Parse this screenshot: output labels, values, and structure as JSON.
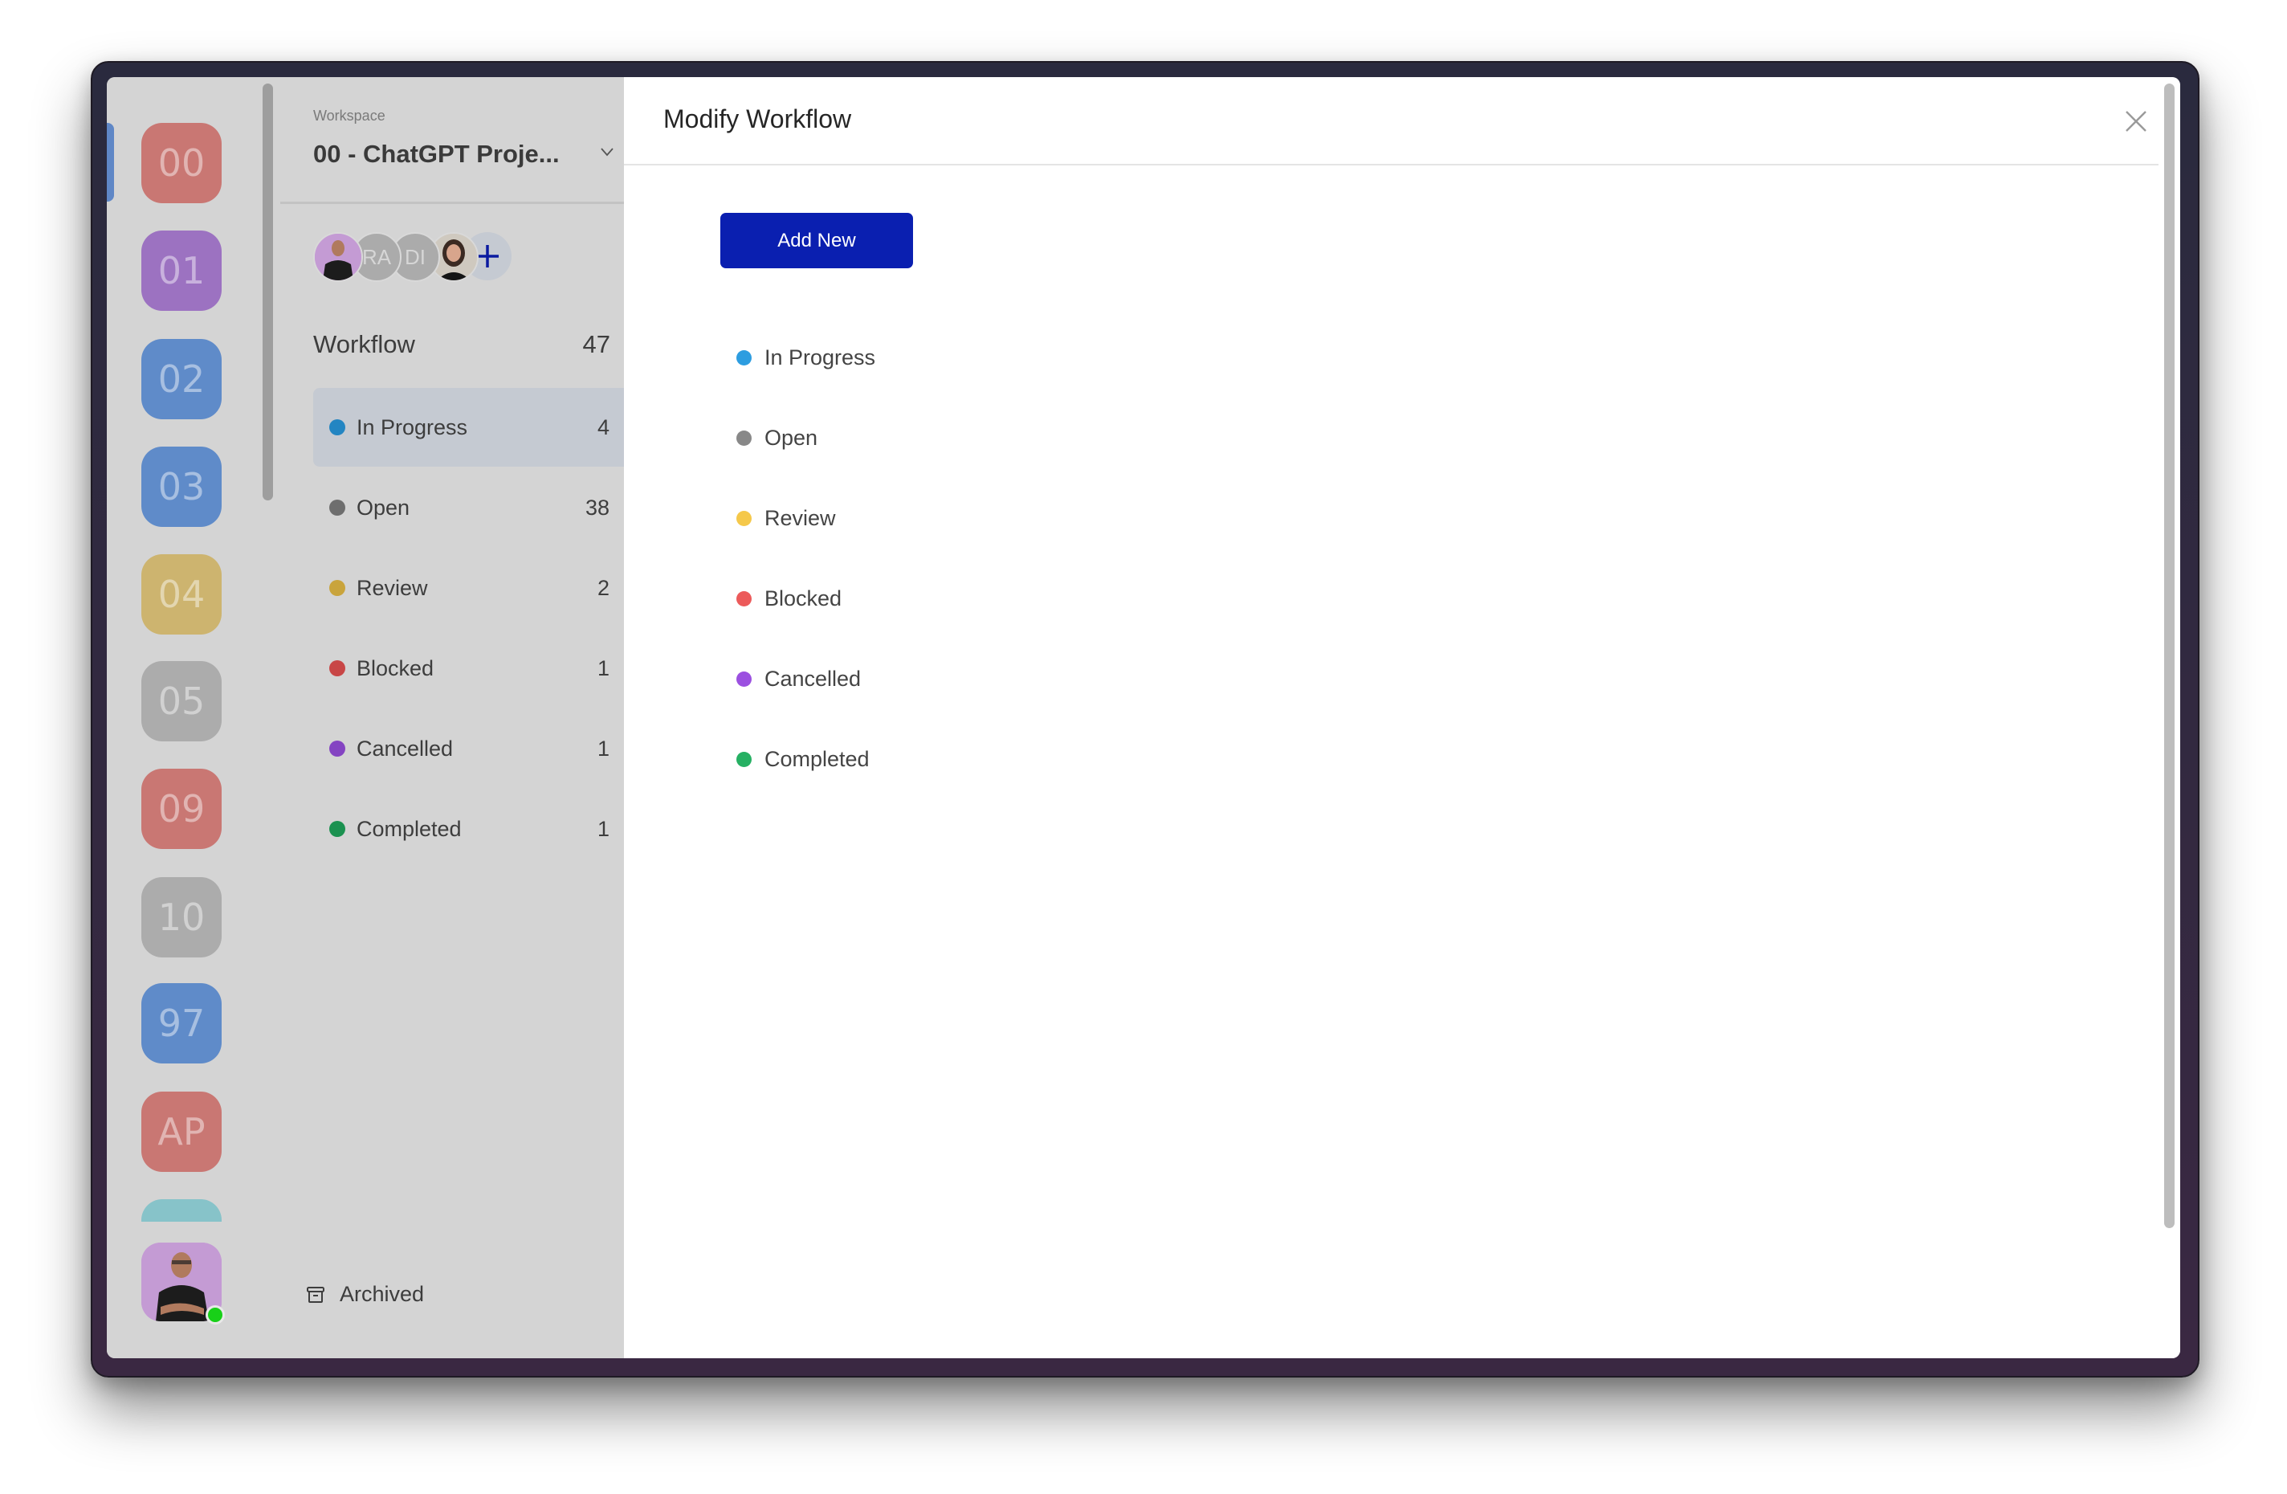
{
  "rail": {
    "tiles": [
      {
        "label": "00",
        "color": "#c97773"
      },
      {
        "label": "01",
        "color": "#9c72c1"
      },
      {
        "label": "02",
        "color": "#5f8bc9"
      },
      {
        "label": "03",
        "color": "#5f8bc9"
      },
      {
        "label": "04",
        "color": "#cdb46f"
      },
      {
        "label": "05",
        "color": "#acacac"
      },
      {
        "label": "09",
        "color": "#c97773"
      },
      {
        "label": "10",
        "color": "#acacac"
      },
      {
        "label": "97",
        "color": "#5f8bc9"
      },
      {
        "label": "AP",
        "color": "#c97773"
      },
      {
        "label": "",
        "color": "#87c3c9"
      }
    ],
    "user_status": "online"
  },
  "sidebar": {
    "workspace_label": "Workspace",
    "workspace_name": "00 - ChatGPT Proje...",
    "members": [
      {
        "type": "photo",
        "name": "user-1"
      },
      {
        "type": "initials",
        "initials": "RA"
      },
      {
        "type": "initials",
        "initials": "DI"
      },
      {
        "type": "photo",
        "name": "user-4"
      }
    ],
    "workflow_title": "Workflow",
    "workflow_total": "47",
    "statuses": [
      {
        "label": "In Progress",
        "count": "4",
        "color": "#2385c2",
        "active": true
      },
      {
        "label": "Open",
        "count": "38",
        "color": "#6e6e6e",
        "active": false
      },
      {
        "label": "Review",
        "count": "2",
        "color": "#c9a43c",
        "active": false
      },
      {
        "label": "Blocked",
        "count": "1",
        "color": "#c84646",
        "active": false
      },
      {
        "label": "Cancelled",
        "count": "1",
        "color": "#8444c2",
        "active": false
      },
      {
        "label": "Completed",
        "count": "1",
        "color": "#1b9150",
        "active": false
      }
    ],
    "archived_label": "Archived"
  },
  "modal": {
    "title": "Modify Workflow",
    "add_new_label": "Add New",
    "statuses": [
      {
        "label": "In Progress",
        "color": "#2d9de0"
      },
      {
        "label": "Open",
        "color": "#888888"
      },
      {
        "label": "Review",
        "color": "#f5c84a"
      },
      {
        "label": "Blocked",
        "color": "#ec5a5a"
      },
      {
        "label": "Cancelled",
        "color": "#9b50e0"
      },
      {
        "label": "Completed",
        "color": "#26b063"
      }
    ]
  }
}
